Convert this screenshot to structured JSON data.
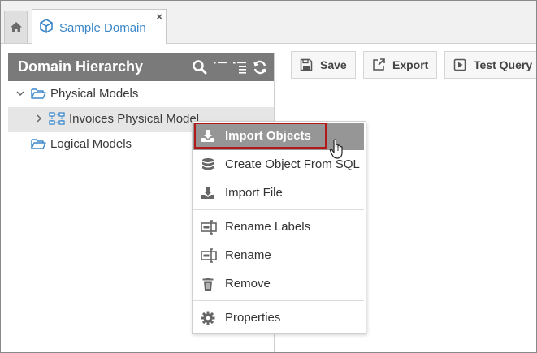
{
  "tabs": {
    "home_icon": "home-icon",
    "active_tab_label": "Sample Domain",
    "active_tab_icon": "domain-icon",
    "close_glyph": "×"
  },
  "panel": {
    "title": "Domain Hierarchy",
    "header_icons": [
      "search-icon",
      "collapse-icon",
      "expand-icon",
      "refresh-icon"
    ],
    "tree": [
      {
        "label": "Physical Models",
        "icon": "folder-open-icon",
        "expanded": true
      },
      {
        "label": "Invoices Physical Model",
        "icon": "schema-icon",
        "expanded": false,
        "selected": true
      },
      {
        "label": "Logical Models",
        "icon": "folder-open-icon"
      }
    ]
  },
  "toolbar": {
    "save_label": "Save",
    "export_label": "Export",
    "test_query_label": "Test Query"
  },
  "context_menu": {
    "items": [
      {
        "label": "Import Objects",
        "icon": "import-icon",
        "highlighted": true
      },
      {
        "label": "Create Object From SQL",
        "icon": "database-icon"
      },
      {
        "label": "Import File",
        "icon": "import-file-icon"
      },
      {
        "label": "Rename Labels",
        "icon": "rename-labels-icon"
      },
      {
        "label": "Rename",
        "icon": "rename-icon"
      },
      {
        "label": "Remove",
        "icon": "trash-icon"
      },
      {
        "label": "Properties",
        "icon": "gear-icon"
      }
    ]
  },
  "colors": {
    "accent": "#3a86c8",
    "panel_header": "#7a7a7a",
    "menu_highlight": "#969696",
    "focus_outline": "#b21818"
  }
}
